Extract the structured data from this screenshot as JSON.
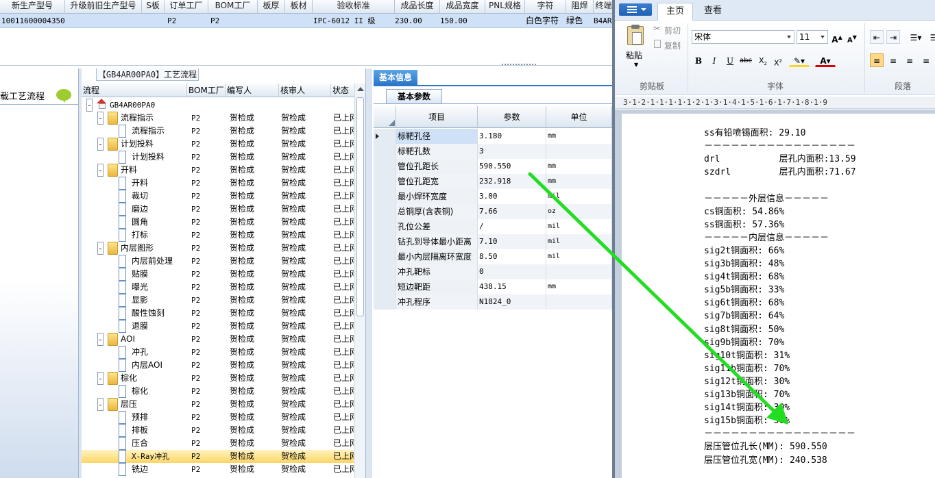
{
  "top_grid": {
    "headers": [
      "新生产型号",
      "升级前旧生产型号",
      "S板",
      "订单工厂",
      "BOM工厂",
      "板厚",
      "板材",
      "验收标准",
      "成品长度",
      "成品宽度",
      "PNL规格",
      "字符",
      "阻焊",
      "终端"
    ],
    "row": [
      "10011600004350",
      "P2",
      "P2",
      "IPC-6012 II 级",
      "230.00",
      "150.00",
      "白色字符",
      "绿色",
      "B4AR"
    ]
  },
  "left_panel": {
    "label": "载工艺流程",
    "chat_icon": "speech-bubble-icon"
  },
  "process": {
    "title": "【GB4AR00PA0】工艺流程",
    "headers": [
      "流程",
      "BOM工厂",
      "编写人",
      "核审人",
      "状态"
    ],
    "rows": [
      {
        "name": "GB4AR00PA0",
        "level": 0,
        "icon": "home-icon",
        "expand": "-",
        "factory": "",
        "writer": "",
        "auditor": "",
        "status": ""
      },
      {
        "name": "流程指示",
        "level": 1,
        "icon": "folder-icon",
        "expand": "-",
        "factory": "P2",
        "writer": "贺检成",
        "auditor": "贺检成",
        "status": "已上网"
      },
      {
        "name": "流程指示",
        "level": 2,
        "icon": "document-icon",
        "factory": "P2",
        "writer": "贺检成",
        "auditor": "贺检成",
        "status": "已上网"
      },
      {
        "name": "计划投料",
        "level": 1,
        "icon": "folder-icon",
        "expand": "-",
        "factory": "P2",
        "writer": "贺检成",
        "auditor": "贺检成",
        "status": "已上网"
      },
      {
        "name": "计划投料",
        "level": 2,
        "icon": "document-icon",
        "factory": "P2",
        "writer": "贺检成",
        "auditor": "贺检成",
        "status": "已上网"
      },
      {
        "name": "开料",
        "level": 1,
        "icon": "folder-icon",
        "expand": "-",
        "factory": "P2",
        "writer": "贺检成",
        "auditor": "贺检成",
        "status": "已上网"
      },
      {
        "name": "开料",
        "level": 2,
        "icon": "document-icon",
        "factory": "P2",
        "writer": "贺检成",
        "auditor": "贺检成",
        "status": "已上网"
      },
      {
        "name": "裁切",
        "level": 2,
        "icon": "document-icon",
        "factory": "P2",
        "writer": "贺检成",
        "auditor": "贺检成",
        "status": "已上网"
      },
      {
        "name": "磨边",
        "level": 2,
        "icon": "document-icon",
        "factory": "P2",
        "writer": "贺检成",
        "auditor": "贺检成",
        "status": "已上网"
      },
      {
        "name": "圆角",
        "level": 2,
        "icon": "document-icon",
        "factory": "P2",
        "writer": "贺检成",
        "auditor": "贺检成",
        "status": "已上网"
      },
      {
        "name": "打标",
        "level": 2,
        "icon": "document-icon",
        "factory": "P2",
        "writer": "贺检成",
        "auditor": "贺检成",
        "status": "已上网"
      },
      {
        "name": "内层图形",
        "level": 1,
        "icon": "folder-icon",
        "expand": "-",
        "factory": "P2",
        "writer": "贺检成",
        "auditor": "贺检成",
        "status": "已上网"
      },
      {
        "name": "内层前处理",
        "level": 2,
        "icon": "document-icon",
        "factory": "P2",
        "writer": "贺检成",
        "auditor": "贺检成",
        "status": "已上网"
      },
      {
        "name": "贴膜",
        "level": 2,
        "icon": "document-icon",
        "factory": "P2",
        "writer": "贺检成",
        "auditor": "贺检成",
        "status": "已上网"
      },
      {
        "name": "曝光",
        "level": 2,
        "icon": "document-icon",
        "factory": "P2",
        "writer": "贺检成",
        "auditor": "贺检成",
        "status": "已上网"
      },
      {
        "name": "显影",
        "level": 2,
        "icon": "document-icon",
        "factory": "P2",
        "writer": "贺检成",
        "auditor": "贺检成",
        "status": "已上网"
      },
      {
        "name": "酸性蚀刻",
        "level": 2,
        "icon": "document-icon",
        "factory": "P2",
        "writer": "贺检成",
        "auditor": "贺检成",
        "status": "已上网"
      },
      {
        "name": "退膜",
        "level": 2,
        "icon": "document-icon",
        "factory": "P2",
        "writer": "贺检成",
        "auditor": "贺检成",
        "status": "已上网"
      },
      {
        "name": "AOI",
        "level": 1,
        "icon": "folder-icon",
        "expand": "-",
        "factory": "P2",
        "writer": "贺检成",
        "auditor": "贺检成",
        "status": "已上网"
      },
      {
        "name": "冲孔",
        "level": 2,
        "icon": "document-icon",
        "factory": "P2",
        "writer": "贺检成",
        "auditor": "贺检成",
        "status": "已上网"
      },
      {
        "name": "内层AOI",
        "level": 2,
        "icon": "document-icon",
        "factory": "P2",
        "writer": "贺检成",
        "auditor": "贺检成",
        "status": "已上网"
      },
      {
        "name": "棕化",
        "level": 1,
        "icon": "folder-icon",
        "expand": "-",
        "factory": "P2",
        "writer": "贺检成",
        "auditor": "贺检成",
        "status": "已上网"
      },
      {
        "name": "棕化",
        "level": 2,
        "icon": "document-icon",
        "factory": "P2",
        "writer": "贺检成",
        "auditor": "贺检成",
        "status": "已上网"
      },
      {
        "name": "层压",
        "level": 1,
        "icon": "folder-icon",
        "expand": "-",
        "factory": "P2",
        "writer": "贺检成",
        "auditor": "贺检成",
        "status": "已上网"
      },
      {
        "name": "预排",
        "level": 2,
        "icon": "document-icon",
        "factory": "P2",
        "writer": "贺检成",
        "auditor": "贺检成",
        "status": "已上网"
      },
      {
        "name": "排板",
        "level": 2,
        "icon": "document-icon",
        "factory": "P2",
        "writer": "贺检成",
        "auditor": "贺检成",
        "status": "已上网"
      },
      {
        "name": "压合",
        "level": 2,
        "icon": "document-icon",
        "factory": "P2",
        "writer": "贺检成",
        "auditor": "贺检成",
        "status": "已上网"
      },
      {
        "name": "X-Ray冲孔",
        "level": 2,
        "icon": "document-icon",
        "factory": "P2",
        "writer": "贺检成",
        "auditor": "贺检成",
        "status": "已上网",
        "selected": true
      },
      {
        "name": "铣边",
        "level": 2,
        "icon": "document-icon",
        "factory": "P2",
        "writer": "贺检成",
        "auditor": "贺检成",
        "status": "已上网"
      }
    ]
  },
  "basic_info": {
    "tab": "基本信息",
    "subtab": "基本参数",
    "headers": [
      "项目",
      "参数",
      "单位"
    ],
    "rows": [
      {
        "item": "标靶孔径",
        "value": "3.180",
        "unit": "mm",
        "selected": true
      },
      {
        "item": "标靶孔数",
        "value": "3",
        "unit": ""
      },
      {
        "item": "管位孔距长",
        "value": "590.550",
        "unit": "mm"
      },
      {
        "item": "管位孔距宽",
        "value": "232.918",
        "unit": "mm"
      },
      {
        "item": "最小焊环宽度",
        "value": "3.00",
        "unit": "mil"
      },
      {
        "item": "总铜厚(含表铜)",
        "value": "7.66",
        "unit": "oz"
      },
      {
        "item": "孔位公差",
        "value": "/",
        "unit": "mil"
      },
      {
        "item": "钻孔到导体最小距离",
        "value": "7.10",
        "unit": "mil"
      },
      {
        "item": "最小内层隔离环宽度",
        "value": "8.50",
        "unit": "mil"
      },
      {
        "item": "冲孔靶标",
        "value": "0",
        "unit": ""
      },
      {
        "item": "短边靶距",
        "value": "438.15",
        "unit": "mm"
      },
      {
        "item": "冲孔程序",
        "value": "N1824_0",
        "unit": ""
      }
    ]
  },
  "word": {
    "tabs": [
      "主页",
      "查看"
    ],
    "clipboard": {
      "paste": "粘贴",
      "cut": "剪切",
      "copy": "复制",
      "group": "剪贴板"
    },
    "font": {
      "name": "宋体",
      "size": "11",
      "group": "字体"
    },
    "paragraph_group": "段落",
    "ruler": "3·1·2·1·1·1·1·1·2·1·3·1·4·1·5·1·6·1·7·1·8·1·9",
    "lines": [
      "ss有铅喷锡面积: 29.10",
      "－－－－－－－－－－－－－－－－－",
      "drl           层孔内面积:13.59",
      "szdrl         层孔内面积:71.67",
      "",
      "－－－－－外层信息－－－－－",
      "cs铜面积: 54.86%",
      "ss铜面积: 57.36%",
      "－－－－－内层信息－－－－－",
      "sig2t铜面积: 66%",
      "sig3b铜面积: 48%",
      "sig4t铜面积: 68%",
      "sig5b铜面积: 33%",
      "sig6t铜面积: 68%",
      "sig7b铜面积: 64%",
      "sig8t铜面积: 50%",
      "sig9b铜面积: 70%",
      "sig10t铜面积: 31%",
      "sig11b铜面积: 70%",
      "sig12t铜面积: 30%",
      "sig13b铜面积: 70%",
      "sig14t铜面积: 30%",
      "sig15b铜面积: 50%",
      "－－－－－－－－－－－－－－－－－",
      "层压管位孔长(MM): 590.550",
      "层压管位孔宽(MM): 240.538"
    ]
  },
  "annotation": {
    "arrow_color": "#22dd22"
  }
}
